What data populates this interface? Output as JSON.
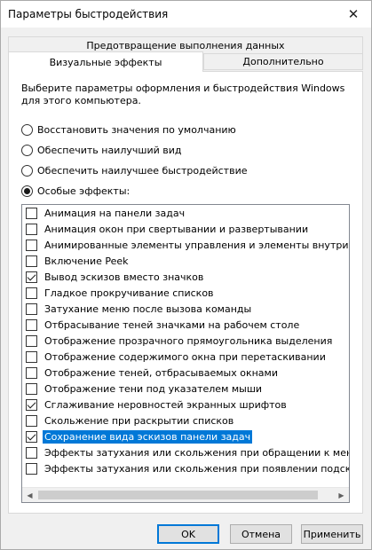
{
  "window": {
    "title": "Параметры быстродействия",
    "close_glyph": "✕"
  },
  "tabs": {
    "data_execution": "Предотвращение выполнения данных",
    "visual_effects": "Визуальные эффекты",
    "advanced": "Дополнительно",
    "active": "visual_effects"
  },
  "description": "Выберите параметры оформления и быстродействия Windows для этого компьютера.",
  "radios": [
    {
      "label": "Восстановить значения по умолчанию",
      "checked": false
    },
    {
      "label": "Обеспечить наилучший вид",
      "checked": false
    },
    {
      "label": "Обеспечить наилучшее быстродействие",
      "checked": false
    },
    {
      "label": "Особые эффекты:",
      "checked": true
    }
  ],
  "effects": [
    {
      "label": "Анимация на панели задач",
      "checked": false
    },
    {
      "label": "Анимация окон при свертывании и развертывании",
      "checked": false
    },
    {
      "label": "Анимированные элементы управления и элементы внутри окна",
      "checked": false
    },
    {
      "label": "Включение Peek",
      "checked": false
    },
    {
      "label": "Вывод эскизов вместо значков",
      "checked": true
    },
    {
      "label": "Гладкое прокручивание списков",
      "checked": false
    },
    {
      "label": "Затухание меню после вызова команды",
      "checked": false
    },
    {
      "label": "Отбрасывание теней значками на рабочем столе",
      "checked": false
    },
    {
      "label": "Отображение прозрачного прямоугольника выделения",
      "checked": false
    },
    {
      "label": "Отображение содержимого окна при перетаскивании",
      "checked": false
    },
    {
      "label": "Отображение теней, отбрасываемых окнами",
      "checked": false
    },
    {
      "label": "Отображение тени под указателем мыши",
      "checked": false
    },
    {
      "label": "Сглаживание неровностей экранных шрифтов",
      "checked": true
    },
    {
      "label": "Скольжение при раскрытии списков",
      "checked": false
    },
    {
      "label": "Сохранение вида эскизов панели задач",
      "checked": true,
      "selected": true
    },
    {
      "label": "Эффекты затухания или скольжения при обращении к меню",
      "checked": false
    },
    {
      "label": "Эффекты затухания или скольжения при появлении подсказок",
      "checked": false
    }
  ],
  "scrollbar": {
    "left_glyph": "◀",
    "right_glyph": "▶"
  },
  "buttons": {
    "ok": "OK",
    "cancel": "Отмена",
    "apply": "Применить"
  },
  "colors": {
    "selection": "#0078d7",
    "default_button_border": "#0078d7"
  }
}
